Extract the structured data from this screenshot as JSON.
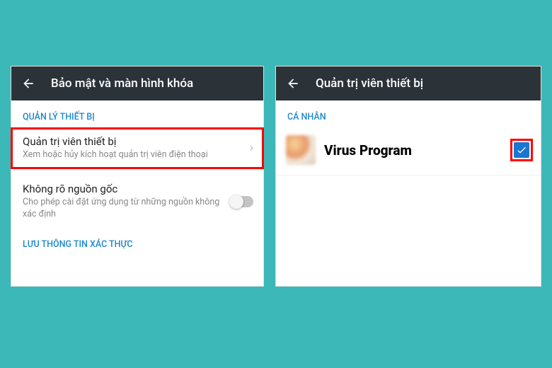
{
  "left": {
    "header_title": "Bảo mật và màn hình khóa",
    "section_device_mgmt": "QUẢN LÝ THIẾT BỊ",
    "admin_item": {
      "title": "Quản trị viên thiết bị",
      "subtitle": "Xem hoặc hủy kích hoạt quản trị viên điện thoại"
    },
    "unknown_sources": {
      "title": "Không rõ nguồn gốc",
      "subtitle": "Cho phép cài đặt ứng dụng từ những nguồn không xác định"
    },
    "section_credentials": "LƯU THÔNG TIN XÁC THỰC"
  },
  "right": {
    "header_title": "Quản trị viên thiết bị",
    "section_personal": "CÁ NHÂN",
    "app_name": "Virus Program",
    "checked": true
  },
  "colors": {
    "accent": "#1e88c9",
    "header_bg": "#2b3339",
    "highlight": "#ff0000",
    "checkbox": "#1976d2"
  }
}
